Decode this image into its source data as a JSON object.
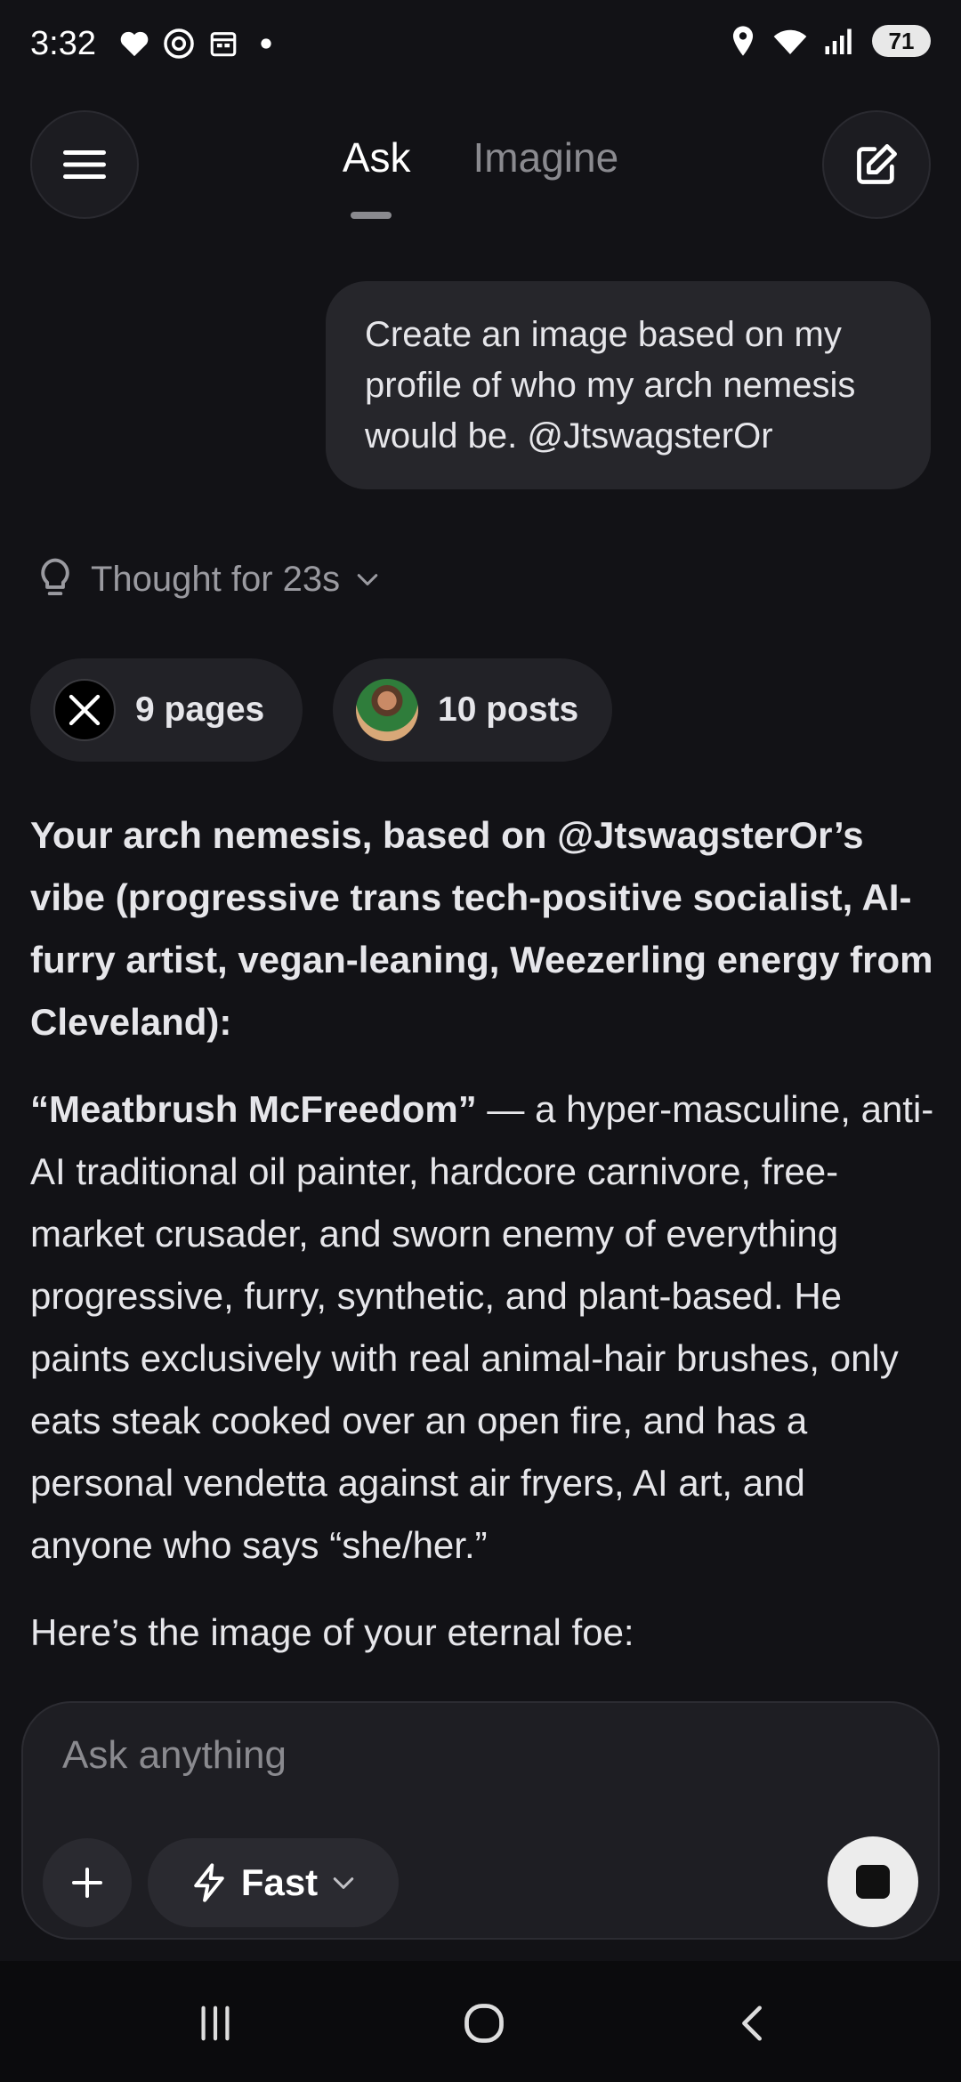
{
  "status_bar": {
    "time": "3:32",
    "battery": "71",
    "icons_left": [
      "heart-icon",
      "threads-icon",
      "calendar-icon",
      "dot-icon"
    ],
    "icons_right": [
      "location-icon",
      "wifi-icon",
      "signal-icon",
      "battery-icon"
    ]
  },
  "header": {
    "tabs": [
      {
        "label": "Ask",
        "active": true
      },
      {
        "label": "Imagine",
        "active": false
      }
    ]
  },
  "chat": {
    "user_message": "Create an image based on my profile of who my arch nemesis would be. @JtswagsterOr",
    "thought_label": "Thought for 23s",
    "sources": [
      {
        "label": "9 pages",
        "icon": "x-logo-icon"
      },
      {
        "label": "10 posts",
        "icon": "avatar"
      }
    ],
    "response": {
      "heading": "Your arch nemesis, based on @JtswagsterOr’s vibe (progressive trans tech-positive socialist, AI-furry artist, vegan-leaning, Weezerling energy from Cleveland):",
      "name_bold": "“Meatbrush McFreedom”",
      "description": " — a hyper-masculine, anti-AI traditional oil painter, hardcore carnivore, free-market crusader, and sworn enemy of everything progressive, furry, synthetic, and plant-based. He paints exclusively with real animal-hair brushes, only eats steak cooked over an open fire, and has a personal vendetta against air fryers, AI art, and anyone who says “she/her.”",
      "closing": "Here’s the image of your eternal foe:"
    }
  },
  "composer": {
    "placeholder": "Ask anything",
    "mode_label": "Fast"
  },
  "colors": {
    "background": "#121216",
    "bubble": "#26262b",
    "chip": "#222227",
    "muted_text": "#8a8a8f"
  }
}
